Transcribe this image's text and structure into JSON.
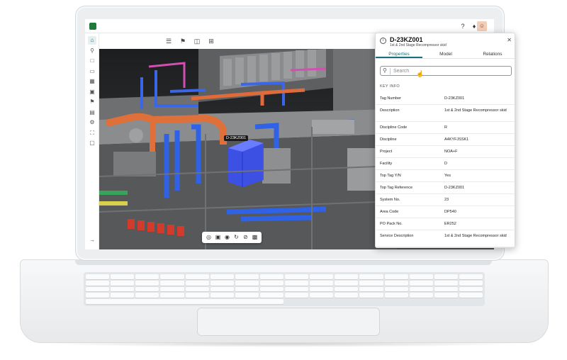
{
  "colors": {
    "accent": "#1b6e7e",
    "brand_green": "#1f7a3a",
    "highlight_blue": "#3a4ff0",
    "pipe_orange": "#e0703a",
    "pipe_blue": "#2f62e6",
    "pipe_magenta": "#d84bb6"
  },
  "topbar": {
    "logo_icon": "app-logo-icon",
    "icons": [
      "help-circle-icon",
      "bell-icon",
      "user-avatar-icon"
    ]
  },
  "leftnav": {
    "items": [
      "home-icon",
      "search-icon",
      "document-icon",
      "folder-icon",
      "layers-icon",
      "report-icon",
      "tag-icon",
      "clipboard-icon",
      "settings-icon",
      "expand-icon",
      "bookmark-icon"
    ],
    "collapse_icon": "arrow-right-icon"
  },
  "toolbar": {
    "icons": [
      "tree-icon",
      "tag-icon",
      "comment-icon",
      "plus-box-icon"
    ]
  },
  "viewport": {
    "selected_label": "D-23KZ001"
  },
  "palette": {
    "icons": [
      "target-icon",
      "fit-icon",
      "eye-icon",
      "rotate-icon",
      "hide-icon",
      "lock-icon"
    ]
  },
  "panel": {
    "title": "D-23KZ001",
    "subtitle": "1st & 2nd Stage Recompressor skid",
    "tabs": [
      {
        "label": "Properties",
        "active": true
      },
      {
        "label": "Model",
        "active": false
      },
      {
        "label": "Relations",
        "active": false
      }
    ],
    "search": {
      "placeholder": "Search",
      "value": ""
    },
    "section": "KEY INFO",
    "rows": [
      {
        "key": "Tag Number",
        "value": "D-23KZ001"
      },
      {
        "key": "Description",
        "value": "1st & 2nd Stage Recompressor skid"
      },
      {
        "key": "Discipline Code",
        "value": "R"
      },
      {
        "key": "Discipline",
        "value": "A4KYFJSSK1"
      },
      {
        "key": "Project",
        "value": "NOA+F"
      },
      {
        "key": "Facility",
        "value": "D"
      },
      {
        "key": "Top Tag Y/N",
        "value": "Yes"
      },
      {
        "key": "Top Tag Reference",
        "value": "D-23KZ001"
      },
      {
        "key": "System No.",
        "value": "23"
      },
      {
        "key": "Area Code",
        "value": "DP540"
      },
      {
        "key": "PO Pack No.",
        "value": "ER252"
      },
      {
        "key": "Service Description",
        "value": "1st & 2nd Stage Recompressor skid"
      }
    ]
  }
}
